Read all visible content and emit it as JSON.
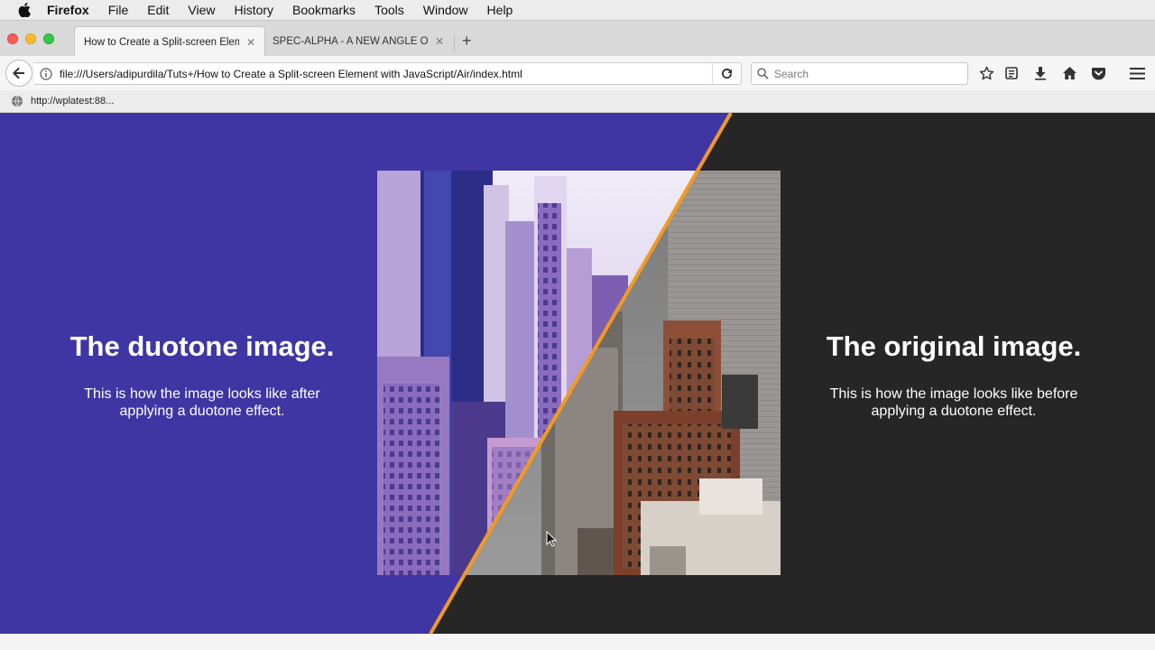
{
  "menubar": {
    "app": "Firefox",
    "items": [
      "File",
      "Edit",
      "View",
      "History",
      "Bookmarks",
      "Tools",
      "Window",
      "Help"
    ]
  },
  "tabs": [
    {
      "title": "How to Create a Split-screen Elem",
      "active": true
    },
    {
      "title": "SPEC-ALPHA - A NEW ANGLE ON",
      "active": false
    }
  ],
  "navbar": {
    "url": "file:///Users/adipurdila/Tuts+/How to Create a Split-screen Element with JavaScript/Air/index.html",
    "search_placeholder": "Search"
  },
  "status": {
    "text": "http://wplatest:88..."
  },
  "page": {
    "left": {
      "title": "The duotone image.",
      "description": "This is how the image looks like after applying a duotone effect.",
      "color": "#3f36a3"
    },
    "right": {
      "title": "The original image.",
      "description": "This is how the image looks like before applying a duotone effect.",
      "color": "#262626"
    },
    "divider_color": "#f29a21"
  }
}
